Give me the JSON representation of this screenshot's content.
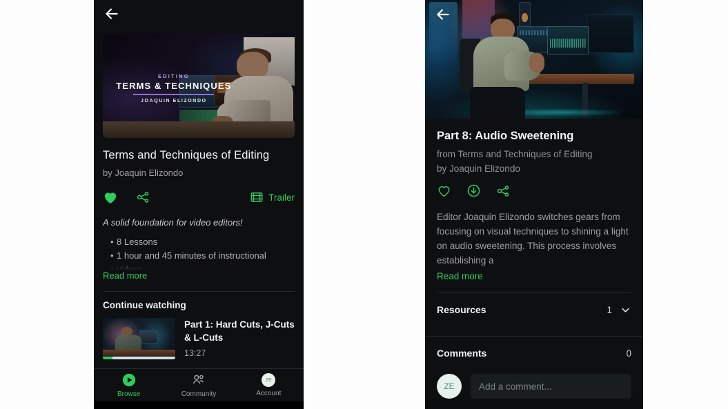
{
  "app": {
    "accent_green": "#2ecc5e",
    "background": "#0d0f11",
    "text_primary": "#f2f4f6",
    "text_secondary": "#9aa1a8"
  },
  "left_screen": {
    "name": "course-detail-screen",
    "back_icon": "back-arrow-icon",
    "hero": {
      "eyebrow": "EDITING",
      "title": "TERMS & TECHNIQUES",
      "author": "JOAQUIN ELIZONDO"
    },
    "course_title": "Terms and Techniques of Editing",
    "author_line": "by Joaquin Elizondo",
    "actions": {
      "like_icon": "heart-filled-icon",
      "share_icon": "share-nodes-icon",
      "trailer_icon": "film-strip-icon",
      "trailer_label": "Trailer"
    },
    "tagline": "A solid foundation for video editors!",
    "bullets": [
      "8 Lessons",
      "1 hour and 45 minutes of instructional",
      "videos"
    ],
    "read_more": "Read more",
    "continue_watching": {
      "section_title": "Continue watching",
      "lesson_title": "Part 1: Hard Cuts, J-Cuts & L-Cuts",
      "duration": "13:27",
      "progress_percent": 13
    },
    "bottom_nav": [
      {
        "label": "Browse",
        "icon": "play-circle-icon",
        "active": true
      },
      {
        "label": "Community",
        "icon": "people-icon",
        "active": false
      },
      {
        "label": "Account",
        "icon": "avatar-icon",
        "active": false,
        "avatar_initials": "ZE"
      }
    ]
  },
  "right_screen": {
    "name": "lesson-detail-screen",
    "back_icon": "back-arrow-icon",
    "title": "Part 8: Audio Sweetening",
    "from_line": "from Terms and Techniques of Editing",
    "author_line": "by Joaquin Elizondo",
    "actions": {
      "like_icon": "heart-outline-icon",
      "download_icon": "download-circle-icon",
      "share_icon": "share-nodes-icon"
    },
    "description": "Editor Joaquin Elizondo switches gears from focusing on visual techniques to shining a light on audio sweetening. This process involves establishing a",
    "read_more": "Read more",
    "resources": {
      "label": "Resources",
      "count": "1",
      "chevron_icon": "chevron-down-icon"
    },
    "comments": {
      "label": "Comments",
      "count": "0",
      "avatar_initials": "ZE",
      "input_value": "",
      "input_placeholder": "Add a comment..."
    }
  }
}
